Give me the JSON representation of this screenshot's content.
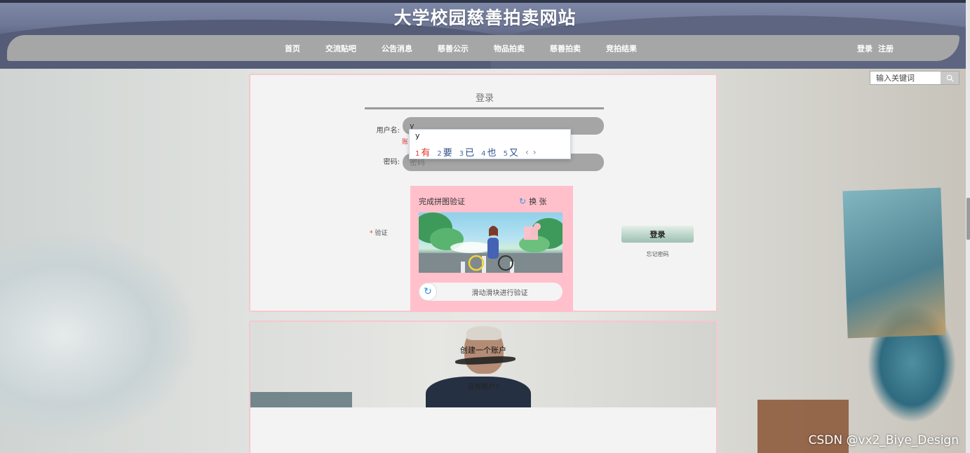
{
  "site": {
    "title": "大学校园慈善拍卖网站"
  },
  "nav": {
    "items": [
      {
        "label": "首页"
      },
      {
        "label": "交流贴吧"
      },
      {
        "label": "公告消息"
      },
      {
        "label": "慈善公示"
      },
      {
        "label": "物品拍卖"
      },
      {
        "label": "慈善拍卖"
      },
      {
        "label": "竞拍结果"
      }
    ],
    "login": "登录",
    "register": "注册"
  },
  "search": {
    "placeholder": "输入关键词",
    "icon": "search-icon"
  },
  "login": {
    "title": "登录",
    "username_label": "用户名:",
    "username_value": "y",
    "username_error": "账",
    "password_label": "密码:",
    "password_placeholder": "密码",
    "verify_label": "验证",
    "submit": "登录",
    "forgot": "忘记密码"
  },
  "captcha": {
    "title": "完成拼图验证",
    "refresh": "换 张",
    "slider_text": "滑动滑块进行验证"
  },
  "ime": {
    "composition": "y",
    "candidates": [
      {
        "num": "1",
        "text": "有"
      },
      {
        "num": "2",
        "text": "要"
      },
      {
        "num": "3",
        "text": "已"
      },
      {
        "num": "4",
        "text": "也"
      },
      {
        "num": "5",
        "text": "又"
      }
    ],
    "prev": "‹",
    "next": "›"
  },
  "register": {
    "create": "创建一个账户",
    "no_account": "没有账户?"
  },
  "watermark": "CSDN @vx2_Biye_Design",
  "colors": {
    "header": "#6f7897",
    "navbar": "#a6a6a6",
    "captcha_bg": "#ffc0cb",
    "panel_border": "#f6c8cf",
    "ime_active": "#e2372a"
  }
}
